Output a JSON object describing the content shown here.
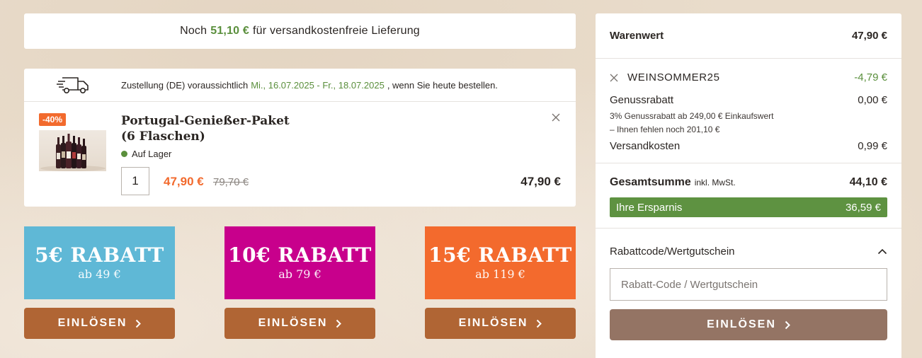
{
  "shipping_banner": {
    "prefix": "Noch",
    "amount": "51,10 €",
    "suffix": "für versandkostenfreie Lieferung"
  },
  "delivery": {
    "prefix": "Zustellung (DE) voraussichtlich",
    "dates": "Mi., 16.07.2025 - Fr., 18.07.2025",
    "suffix": ", wenn Sie heute bestellen."
  },
  "cart_item": {
    "badge": "-40%",
    "title": "Portugal-Genießer-Paket (6 Flaschen)",
    "stock": "Auf Lager",
    "quantity": "1",
    "price": "47,90 €",
    "old_price": "79,70 €",
    "total": "47,90 €"
  },
  "promos": [
    {
      "title": "5€ RABATT",
      "subtitle": "ab 49 €",
      "button": "EINLÖSEN",
      "color": "#5fb8d6"
    },
    {
      "title": "10€ RABATT",
      "subtitle": "ab 79 €",
      "button": "EINLÖSEN",
      "color": "#c8008c"
    },
    {
      "title": "15€ RABATT",
      "subtitle": "ab 119 €",
      "button": "EINLÖSEN",
      "color": "#f36a2d"
    }
  ],
  "summary": {
    "warenwert_label": "Warenwert",
    "warenwert_value": "47,90 €",
    "coupon_code": "WEINSOMMER25",
    "coupon_value": "-4,79 €",
    "genussrabatt_label": "Genussrabatt",
    "genussrabatt_value": "0,00 €",
    "genussrabatt_note1": "3% Genussrabatt ab 249,00 € Einkaufswert",
    "genussrabatt_note2": "– Ihnen fehlen noch 201,10 €",
    "versand_label": "Versandkosten",
    "versand_value": "0,99 €",
    "total_label": "Gesamtsumme",
    "total_incl": "inkl. MwSt.",
    "total_value": "44,10 €",
    "savings_label": "Ihre Ersparnis",
    "savings_value": "36,59 €"
  },
  "voucher": {
    "heading": "Rabattcode/Wertgutschein",
    "placeholder": "Rabatt-Code / Wertgutschein",
    "button": "EINLÖSEN"
  },
  "colors": {
    "accent_green": "#5a8f3c",
    "accent_orange": "#f26a2d",
    "button_brown": "#b06534",
    "button_muted": "#947464"
  }
}
